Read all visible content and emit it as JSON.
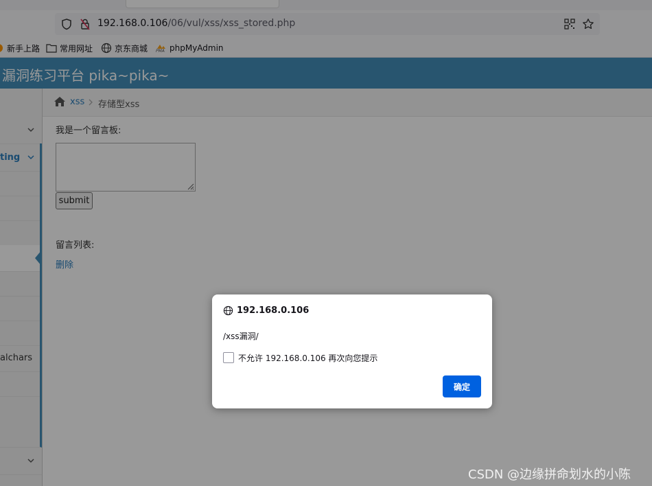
{
  "browser": {
    "url_host": "192.168.0.106",
    "url_path": "/06/vul/xss/xss_stored.php",
    "bookmarks": [
      "新手上路",
      "常用网址",
      "京东商城",
      "phpMyAdmin"
    ],
    "pma_badge": "PMA"
  },
  "page": {
    "title": "漏洞练习平台 pika~pika~",
    "breadcrumb": [
      "xss",
      "存储型xss"
    ],
    "board_label": "我是一个留言板:",
    "submit_label": "submit",
    "list_label": "留言列表:",
    "delete_link": "删除"
  },
  "sidebar": {
    "partial_text_1": "ting",
    "partial_text_2": "alchars",
    "accent_color": "#438eb9"
  },
  "dialog": {
    "host": "192.168.0.106",
    "message": "/xss漏洞/",
    "checkbox_label": "不允许 192.168.0.106 再次向您提示",
    "ok_label": "确定"
  },
  "watermark": "CSDN @边缘拼命划水的小陈"
}
